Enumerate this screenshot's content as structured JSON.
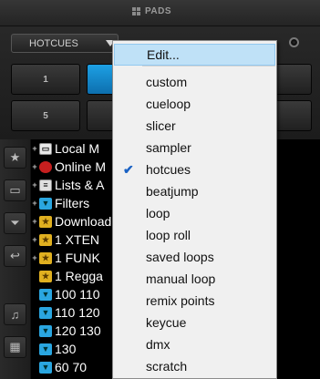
{
  "pads": {
    "title": "PADS",
    "mode_value": "HOTCUES",
    "pad_row1": [
      "1",
      "",
      "",
      ""
    ],
    "pad_row2": [
      "5",
      "",
      "",
      ""
    ]
  },
  "browser": {
    "tree_items": [
      {
        "label": "Local M",
        "icon": "local-computer-icon",
        "expander": "+"
      },
      {
        "label": "Online M",
        "icon": "online-music-icon",
        "expander": "+"
      },
      {
        "label": "Lists & A",
        "icon": "lists-icon",
        "expander": "+"
      },
      {
        "label": "Filters",
        "icon": "filter-folder-icon",
        "expander": "+"
      },
      {
        "label": "Download",
        "icon": "star-folder-icon",
        "expander": "+"
      },
      {
        "label": "1 XTEN",
        "icon": "star-folder-icon",
        "expander": "+"
      },
      {
        "label": "1 FUNK",
        "icon": "star-folder-icon",
        "expander": "+"
      },
      {
        "label": "1 Regga",
        "icon": "star-folder-icon",
        "expander": ""
      },
      {
        "label": "100 110",
        "icon": "filter-folder-icon",
        "expander": ""
      },
      {
        "label": "110 120",
        "icon": "filter-folder-icon",
        "expander": ""
      },
      {
        "label": "120 130",
        "icon": "filter-folder-icon",
        "expander": ""
      },
      {
        "label": "130",
        "icon": "filter-folder-icon",
        "expander": ""
      },
      {
        "label": "60 70",
        "icon": "filter-folder-icon",
        "expander": ""
      }
    ],
    "toolbar_icons": [
      "star-add-icon",
      "folder-add-icon",
      "filter-add-icon",
      "back-arrow-icon",
      "music-note-icon",
      "film-icon"
    ]
  },
  "menu": {
    "items": [
      {
        "label": "Edit...",
        "state": "highlighted"
      },
      {
        "label": "custom",
        "state": ""
      },
      {
        "label": "cueloop",
        "state": ""
      },
      {
        "label": "slicer",
        "state": ""
      },
      {
        "label": "sampler",
        "state": ""
      },
      {
        "label": "hotcues",
        "state": "checked"
      },
      {
        "label": "beatjump",
        "state": ""
      },
      {
        "label": "loop",
        "state": ""
      },
      {
        "label": "loop roll",
        "state": ""
      },
      {
        "label": "saved loops",
        "state": ""
      },
      {
        "label": "manual loop",
        "state": ""
      },
      {
        "label": "remix points",
        "state": ""
      },
      {
        "label": "keycue",
        "state": ""
      },
      {
        "label": "dmx",
        "state": ""
      },
      {
        "label": "scratch",
        "state": ""
      }
    ]
  },
  "colors": {
    "accent": "#1a8fd6",
    "menu_highlight": "#bfe1f7",
    "check": "#1a62c4",
    "panel": "#262626"
  }
}
